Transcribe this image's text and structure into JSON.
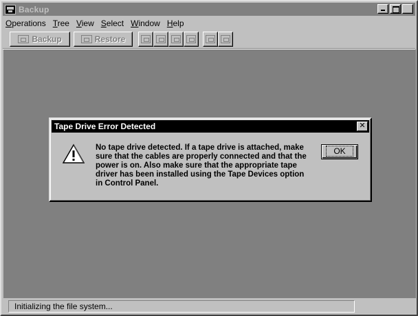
{
  "window": {
    "title": "Backup",
    "controls": {
      "minimize": "_",
      "maximize": "□",
      "close": "✕"
    },
    "icon": "tape-backup-icon"
  },
  "menubar": {
    "items": [
      {
        "label": "Operations",
        "accel": "O",
        "rest": "perations"
      },
      {
        "label": "Tree",
        "accel": "T",
        "rest": "ree"
      },
      {
        "label": "View",
        "accel": "V",
        "rest": "iew"
      },
      {
        "label": "Select",
        "accel": "S",
        "rest": "elect"
      },
      {
        "label": "Window",
        "accel": "W",
        "rest": "indow"
      },
      {
        "label": "Help",
        "accel": "H",
        "rest": "elp"
      }
    ]
  },
  "toolbar": {
    "backup_label": "Backup",
    "restore_label": "Restore",
    "small_buttons": [
      "catalog-icon",
      "retension-icon",
      "eject-icon",
      "erase-icon",
      "check-icon",
      "uncheck-icon"
    ]
  },
  "dialog": {
    "title": "Tape Drive Error Detected",
    "close": "✕",
    "icon": "warning-icon",
    "message": "No tape drive detected. If a tape drive is attached, make sure that the cables are properly connected and that the power is on. Also make sure that the appropriate tape driver has been installed using the Tape Devices option in Control Panel.",
    "ok_label": "OK"
  },
  "status": {
    "text": "Initializing the file system..."
  }
}
